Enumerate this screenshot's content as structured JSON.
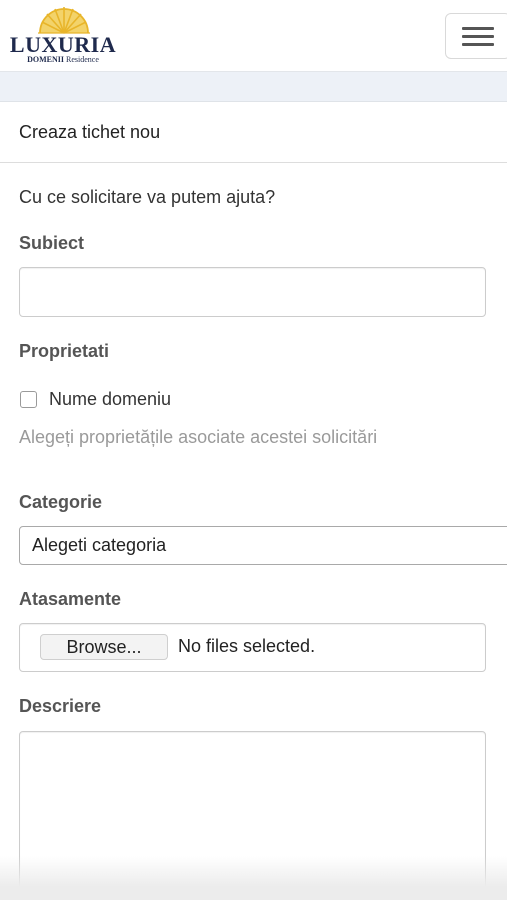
{
  "header": {
    "logo_name": "LUXURIA",
    "logo_sub_bold": "DOMENII",
    "logo_sub": "Residence",
    "menu_icon": "hamburger-icon"
  },
  "panel": {
    "title": "Creaza tichet nou"
  },
  "form": {
    "intro": "Cu ce solicitare va putem ajuta?",
    "subject_label": "Subiect",
    "subject_value": "",
    "properties_label": "Proprietati",
    "property_option": "Nume domeniu",
    "property_checked": false,
    "properties_help": "Alegeți proprietățile asociate acestei solicitări",
    "category_label": "Categorie",
    "category_value": "Alegeti categoria",
    "attachments_label": "Atasamente",
    "browse_label": "Browse...",
    "file_status": "No files selected.",
    "description_label": "Descriere",
    "description_value": ""
  },
  "colors": {
    "logo_gold": "#e8b52a",
    "logo_navy": "#1f2a4d",
    "strip_bg": "#edf1f7"
  }
}
